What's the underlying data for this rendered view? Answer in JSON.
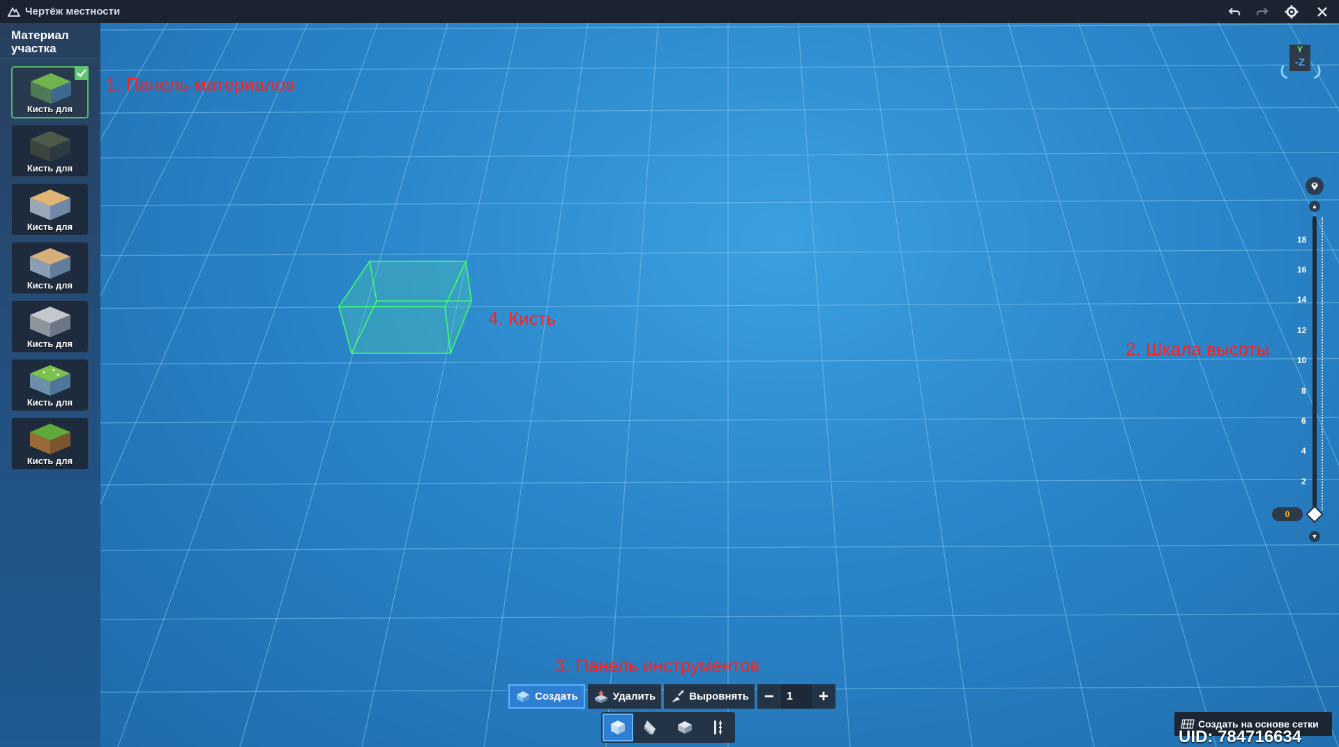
{
  "window": {
    "title": "Чертёж местности"
  },
  "sidebar": {
    "title": "Материал участка",
    "brushes": [
      {
        "label": "Кисть для",
        "material": "grass",
        "selected": true
      },
      {
        "label": "Кисть для",
        "material": "dark-stone",
        "selected": false
      },
      {
        "label": "Кисть для",
        "material": "sand",
        "selected": false
      },
      {
        "label": "Кисть для",
        "material": "sand-dirt",
        "selected": false
      },
      {
        "label": "Кисть для",
        "material": "gray-rock",
        "selected": false
      },
      {
        "label": "Кисть для",
        "material": "flower-grass",
        "selected": false
      },
      {
        "label": "Кисть для",
        "material": "grass-soil",
        "selected": false
      }
    ]
  },
  "annotations": {
    "materials_panel": "1. Панель материалов",
    "height_scale": "2. Шкала высоты",
    "tool_panel": "3. Панель инструментов",
    "brush": "4. Кисть"
  },
  "orientation": {
    "y_label": "Y",
    "z_label": "-Z"
  },
  "height_scale": {
    "ticks": [
      "18",
      "16",
      "14",
      "12",
      "10",
      "8",
      "6",
      "4",
      "2"
    ],
    "current": "0"
  },
  "toolbar": {
    "create_label": "Создать",
    "delete_label": "Удалить",
    "level_label": "Выровнять",
    "stepper_value": "1",
    "active": "create"
  },
  "modes": {
    "active": "cube"
  },
  "footer": {
    "grid_create_label": "Создать на основе сетки",
    "uid": "UID: 784716634"
  },
  "colors": {
    "selected_check": "#5cc86e",
    "annotation": "#ff2020",
    "brush_outline": "#3dff6a",
    "active_button": "#2d7fd4"
  }
}
